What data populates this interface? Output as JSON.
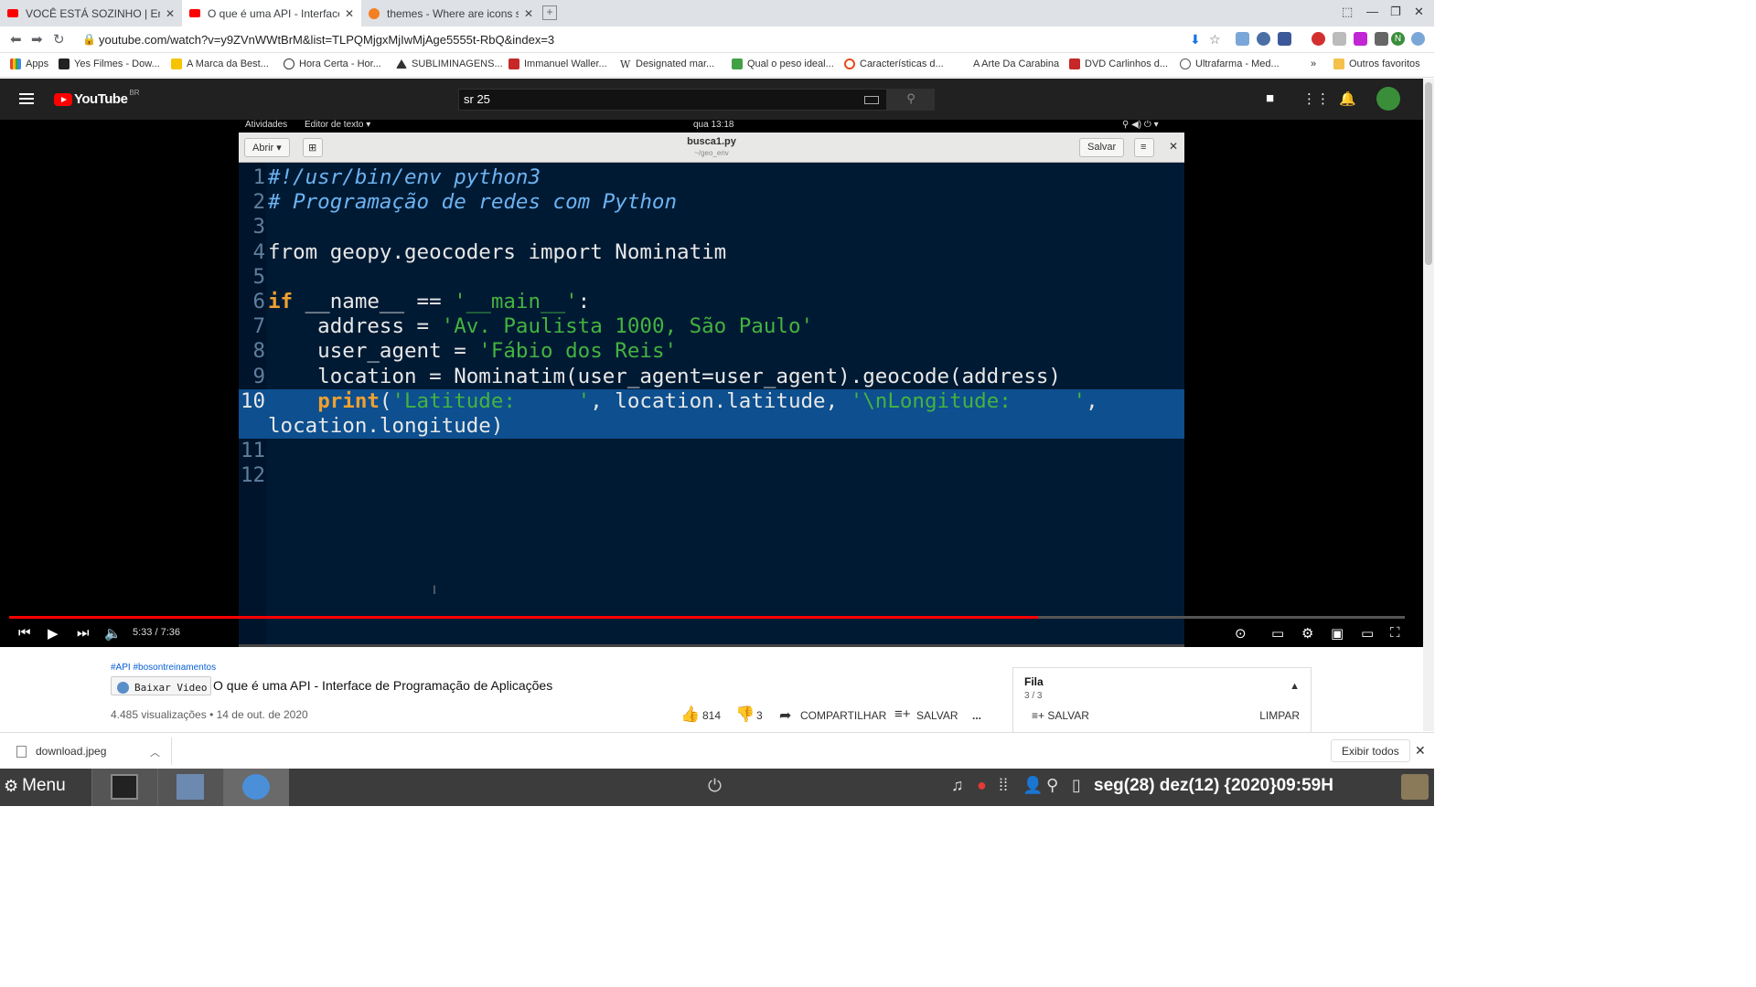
{
  "browser": {
    "tabs": [
      {
        "title": "VOCÊ ESTÁ SOZINHO | Entend",
        "icon": "youtube-icon",
        "active": false
      },
      {
        "title": "O que é uma API - Interface d",
        "icon": "youtube-icon",
        "active": true
      },
      {
        "title": "themes - Where are icons stor",
        "icon": "askubuntu-icon",
        "active": false
      }
    ],
    "url": "youtube.com/watch?v=y9ZVnWWtBrM&list=TLPQMjgxMjIwMjAge5555t-RbQ&index=3",
    "bookmarks": [
      "Apps",
      "Yes Filmes - Dow...",
      "A Marca da Best...",
      "Hora Certa - Hor...",
      "SUBLIMINAGENS...",
      "Immanuel Waller...",
      "Designated mar...",
      "Qual o peso ideal...",
      "Características d...",
      "A Arte Da Carabina",
      "DVD Carlinhos d...",
      "Ultrafarma - Med..."
    ],
    "bookmarks_overflow": "»",
    "other_bookmarks": "Outros favoritos",
    "profile_initial": "N"
  },
  "youtube": {
    "logo_text": "YouTube",
    "region": "BR",
    "search_value": "sr 25"
  },
  "video": {
    "gnome_bar": {
      "activities": "Atividades",
      "app": "Editor de texto ▾",
      "clock": "qua 13:18"
    },
    "editor": {
      "open_label": "Abrir",
      "filename": "busca1.py",
      "path": "~/geo_env",
      "save_label": "Salvar",
      "highlight_line": 10,
      "lines": [
        {
          "n": "1",
          "tokens": [
            {
              "t": "#!/usr/bin/env python3",
              "c": "cmt"
            }
          ]
        },
        {
          "n": "2",
          "tokens": [
            {
              "t": "# Programação de redes com Python",
              "c": "cmt"
            }
          ]
        },
        {
          "n": "3",
          "tokens": []
        },
        {
          "n": "4",
          "tokens": [
            {
              "t": "from geopy.geocoders import Nominatim",
              "c": ""
            }
          ]
        },
        {
          "n": "5",
          "tokens": []
        },
        {
          "n": "6",
          "tokens": [
            {
              "t": "if",
              "c": "kw"
            },
            {
              "t": " __name__ == ",
              "c": ""
            },
            {
              "t": "'__main__'",
              "c": "str"
            },
            {
              "t": ":",
              "c": ""
            }
          ]
        },
        {
          "n": "7",
          "tokens": [
            {
              "t": "    address = ",
              "c": ""
            },
            {
              "t": "'Av. Paulista 1000, São Paulo'",
              "c": "str"
            }
          ]
        },
        {
          "n": "8",
          "tokens": [
            {
              "t": "    user_agent = ",
              "c": ""
            },
            {
              "t": "'Fábio dos Reis'",
              "c": "str"
            }
          ]
        },
        {
          "n": "9",
          "tokens": [
            {
              "t": "    location = Nominatim(user_agent=user_agent).geocode(address)",
              "c": ""
            }
          ]
        },
        {
          "n": "10",
          "tokens": [
            {
              "t": "    ",
              "c": ""
            },
            {
              "t": "print",
              "c": "kw"
            },
            {
              "t": "(",
              "c": ""
            },
            {
              "t": "'Latitude:     '",
              "c": "str"
            },
            {
              "t": ", location.latitude, ",
              "c": ""
            },
            {
              "t": "'\\nLongitude:     '",
              "c": "str"
            },
            {
              "t": ",",
              "c": ""
            }
          ]
        },
        {
          "n": "",
          "tokens": [
            {
              "t": "location.longitude)",
              "c": ""
            }
          ]
        },
        {
          "n": "11",
          "tokens": []
        },
        {
          "n": "12",
          "tokens": []
        }
      ]
    },
    "player": {
      "time": "5:33 / 7:36",
      "progress": 0.737
    }
  },
  "info": {
    "hashtags": "#API #bosontreinamentos",
    "download_btn": "Baixar Video",
    "title": "O que é uma API - Interface de Programação de Aplicações",
    "views": "4.485 visualizações • 14 de out. de 2020",
    "likes": "814",
    "dislikes": "3",
    "share": "COMPARTILHAR",
    "save": "SALVAR",
    "more": "...",
    "queue": {
      "title": "Fila",
      "count": "3 / 3",
      "save": "SALVAR",
      "clear": "LIMPAR"
    }
  },
  "downloads": {
    "file": "download.jpeg",
    "show_all": "Exibir todos"
  },
  "taskbar": {
    "menu": "Menu",
    "clock": "seg(28) dez(12) {2020}09:59H"
  }
}
